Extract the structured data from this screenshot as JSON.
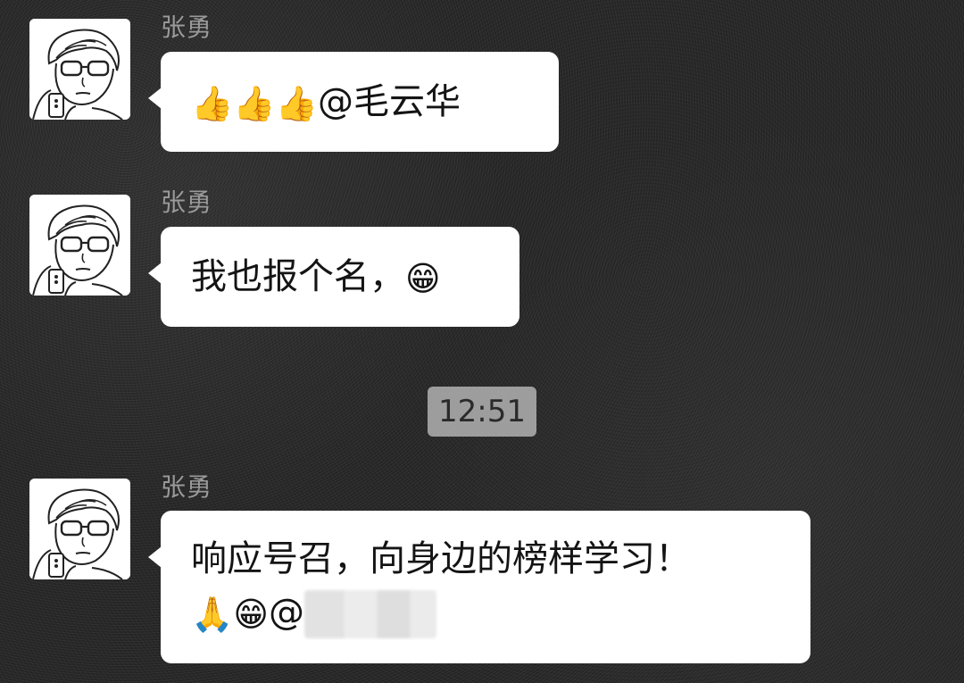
{
  "messages": [
    {
      "sender": "张勇",
      "lines": [
        {
          "parts": [
            {
              "type": "emoji",
              "icon": "thumbs-up-icon",
              "char": "👍"
            },
            {
              "type": "emoji",
              "icon": "thumbs-up-icon",
              "char": "👍"
            },
            {
              "type": "emoji",
              "icon": "thumbs-up-icon",
              "char": "👍"
            },
            {
              "type": "text",
              "value": "@毛云华"
            }
          ]
        }
      ]
    },
    {
      "sender": "张勇",
      "lines": [
        {
          "parts": [
            {
              "type": "text",
              "value": "我也报个名，"
            },
            {
              "type": "emoji",
              "icon": "grinning-face-icon",
              "char": "😁"
            }
          ]
        }
      ]
    },
    {
      "sender": "张勇",
      "lines": [
        {
          "parts": [
            {
              "type": "text",
              "value": "响应号召，向身边的榜样学习！"
            }
          ]
        },
        {
          "parts": [
            {
              "type": "emoji",
              "icon": "praying-hands-icon",
              "char": "🙏"
            },
            {
              "type": "emoji",
              "icon": "grinning-face-icon",
              "char": "😁"
            },
            {
              "type": "text",
              "value": "@"
            },
            {
              "type": "redacted",
              "icon": "redacted-name-block"
            }
          ]
        }
      ]
    }
  ],
  "timestamp": "12:51",
  "colors": {
    "background": "#262626",
    "bubble": "#ffffff",
    "sender_name": "#9a9a9a",
    "time_badge": "#bebebe"
  }
}
